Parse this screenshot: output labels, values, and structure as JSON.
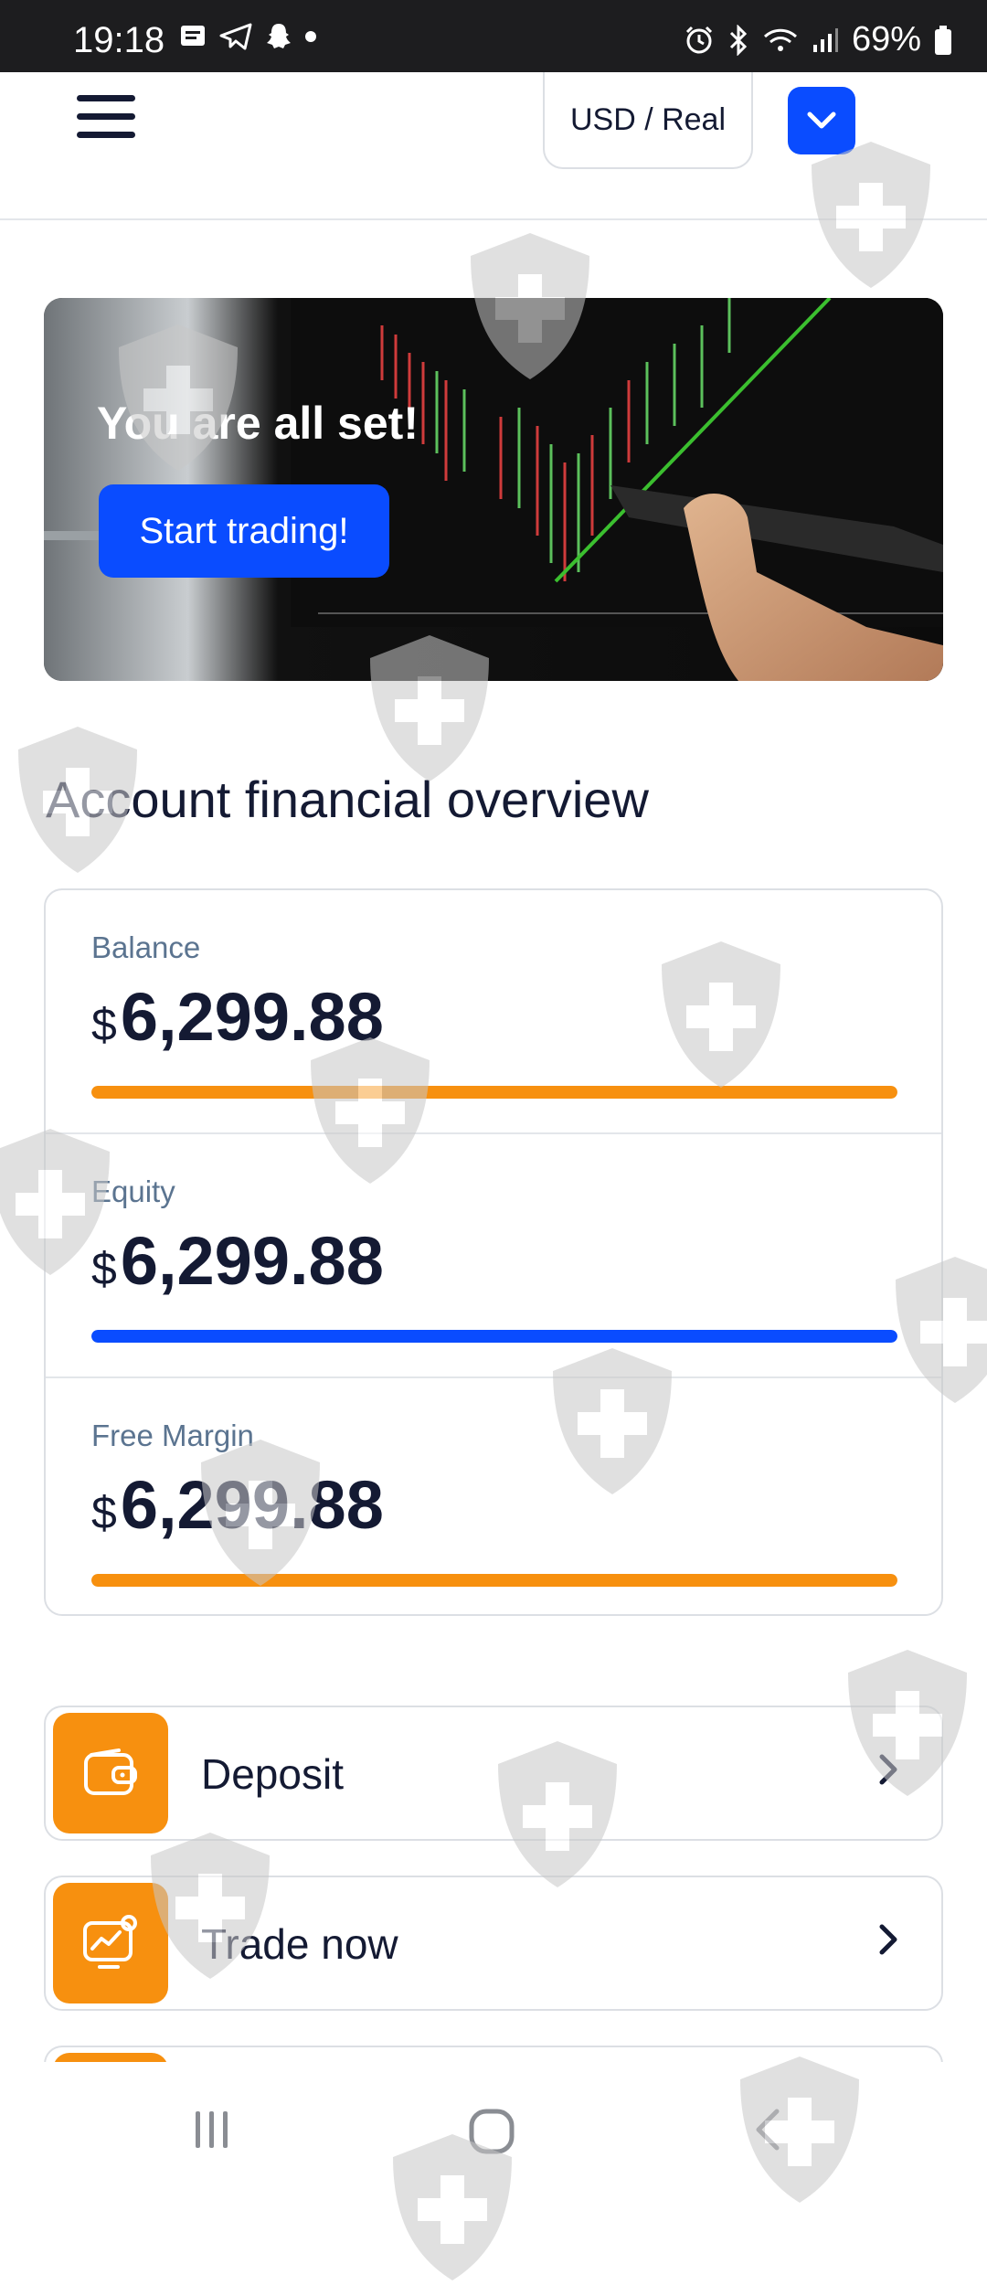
{
  "status_bar": {
    "time": "19:18",
    "battery": "69%",
    "notification_icons": [
      "message-icon",
      "telegram-icon",
      "snapchat-icon"
    ],
    "system_icons": [
      "alarm-icon",
      "bluetooth-icon",
      "wifi-icon",
      "signal-icon",
      "battery-icon"
    ]
  },
  "header": {
    "account_selector": "USD / Real",
    "menu_icon": "hamburger-icon",
    "toggle_icon": "chevron-down-icon"
  },
  "banner": {
    "title": "You are all set!",
    "button_label": "Start trading!"
  },
  "overview": {
    "title": "Account financial overview",
    "rows": [
      {
        "label": "Balance",
        "currency": "$",
        "value": "6,299.88",
        "bar_color": "#f7900f",
        "bar_fill": 1.0
      },
      {
        "label": "Equity",
        "currency": "$",
        "value": "6,299.88",
        "bar_color": "#0a4cff",
        "bar_fill": 1.0
      },
      {
        "label": "Free Margin",
        "currency": "$",
        "value": "6,299.88",
        "bar_color": "#f7900f",
        "bar_fill": 1.0
      }
    ]
  },
  "actions": [
    {
      "label": "Deposit",
      "icon": "wallet-icon"
    },
    {
      "label": "Trade now",
      "icon": "trade-chart-icon"
    }
  ],
  "colors": {
    "accent_blue": "#0a4cff",
    "accent_orange": "#f7900f",
    "text_dark": "#141a33",
    "label_gray": "#5b7490"
  }
}
